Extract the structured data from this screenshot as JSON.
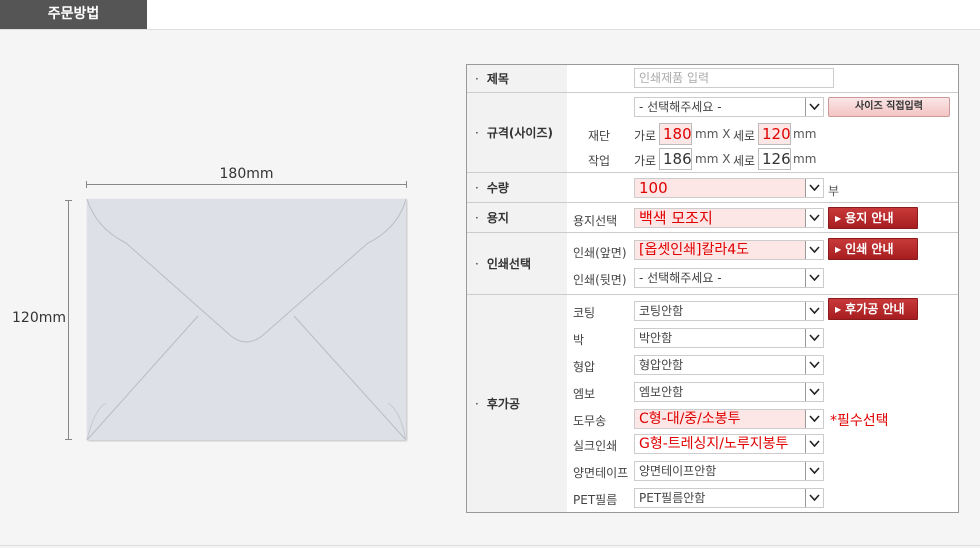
{
  "header": {
    "title": "주문방법"
  },
  "envelope": {
    "width_label": "180mm",
    "height_label": "120mm"
  },
  "form": {
    "title": {
      "label": "제목",
      "placeholder": "인쇄제품 입력"
    },
    "size": {
      "label": "규격(사이즈)",
      "select_value": "- 선택해주세요 -",
      "direct_button": "사이즈 직접입력",
      "cut": {
        "label": "재단",
        "w_label": "가로",
        "w_value": "180",
        "unit1": "mm X",
        "h_label": "세로",
        "h_value": "120",
        "unit2": "mm"
      },
      "work": {
        "label": "작업",
        "w_label": "가로",
        "w_value": "186",
        "unit1": "mm X",
        "h_label": "세로",
        "h_value": "126",
        "unit2": "mm"
      }
    },
    "quantity": {
      "label": "수량",
      "value": "100",
      "unit": "부"
    },
    "paper": {
      "label": "용지",
      "sub_label": "용지선택",
      "value": "백색 모조지",
      "guide_button": "용지 안내"
    },
    "print": {
      "label": "인쇄선택",
      "front_label": "인쇄(앞면)",
      "front_value": "[옵셋인쇄]칼라4도",
      "back_label": "인쇄(뒷면)",
      "back_value": "- 선택해주세요 -",
      "guide_button": "인쇄 안내"
    },
    "post": {
      "label": "후가공",
      "guide_button": "후가공 안내",
      "required_note": "*필수선택",
      "items": [
        {
          "label": "코팅",
          "value": "코팅안함"
        },
        {
          "label": "박",
          "value": "박안함"
        },
        {
          "label": "형압",
          "value": "형압안함"
        },
        {
          "label": "엠보",
          "value": "엠보안함"
        },
        {
          "label": "도무송",
          "value": "C형-대/중/소봉투"
        },
        {
          "label": "실크인쇄",
          "value": "G형-트레싱지/노루지봉투"
        },
        {
          "label": "양면테이프",
          "value": "양면테이프안함"
        },
        {
          "label": "PET필름",
          "value": "PET필름안함"
        }
      ]
    }
  }
}
